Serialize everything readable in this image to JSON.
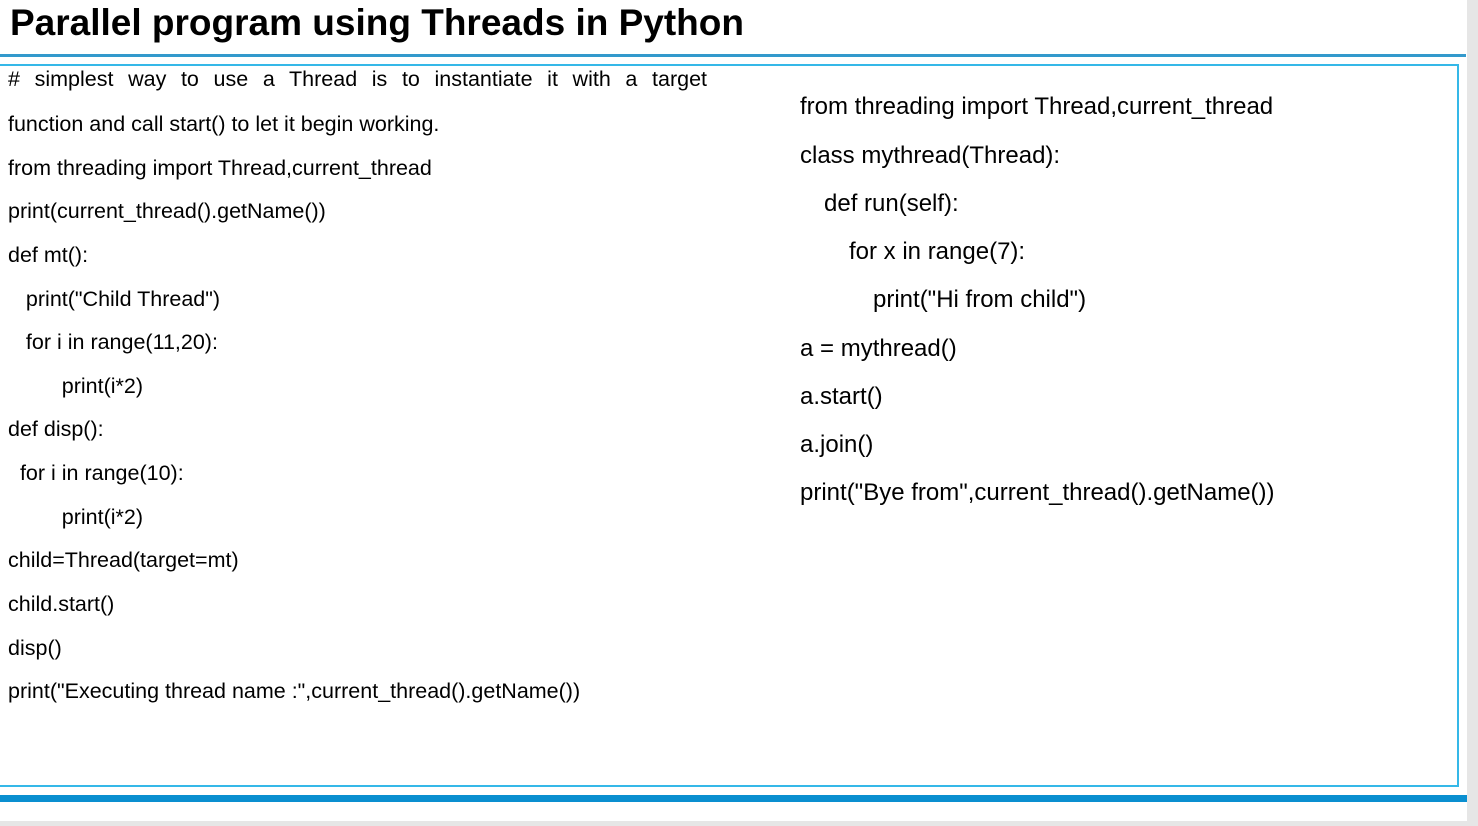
{
  "title": "Parallel program using Threads in Python",
  "left_code": [
    "# simplest way to use a Thread is to instantiate it with a target",
    "function and call start() to let it begin working.",
    "from threading import Thread,current_thread",
    "print(current_thread().getName())",
    "def mt():",
    "   print(\"Child Thread\")",
    "   for i in range(11,20):",
    "         print(i*2)",
    "def disp():",
    "  for i in range(10):",
    "         print(i*2)",
    "child=Thread(target=mt)",
    "child.start()",
    "disp()",
    "print(\"Executing thread name :\",current_thread().getName())"
  ],
  "right_code": [
    "from threading import Thread,current_thread",
    "class mythread(Thread):",
    "def run(self):",
    "for x in range(7):",
    "print(\"Hi from child\")",
    "a = mythread()",
    "a.start()",
    "a.join()",
    "print(\"Bye from\",current_thread().getName())"
  ]
}
